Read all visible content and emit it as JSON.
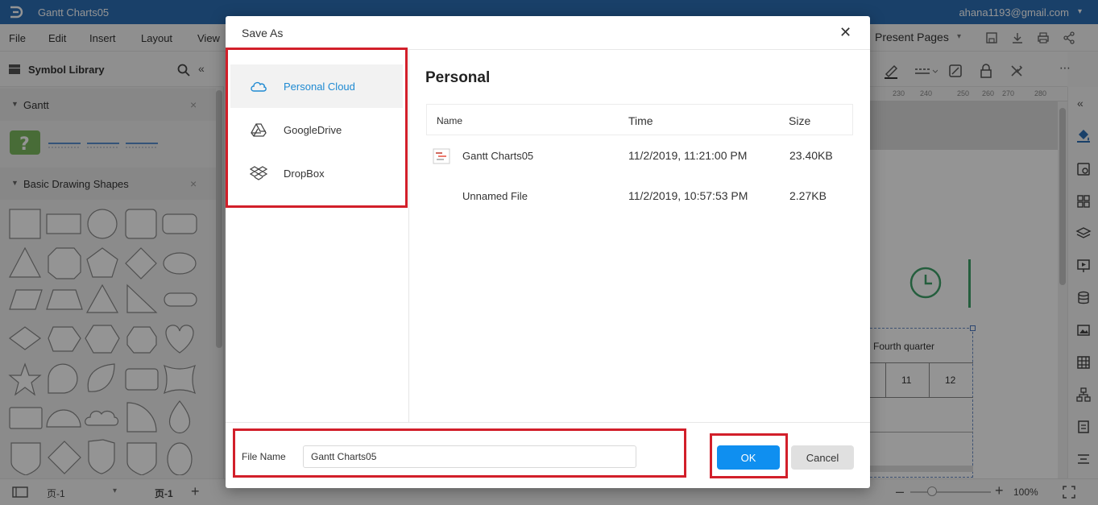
{
  "app": {
    "document_title": "Gantt Charts05",
    "account": "ahana1193@gmail.com",
    "menu": [
      "File",
      "Edit",
      "Insert",
      "Layout",
      "View"
    ],
    "present_pages": "Present Pages"
  },
  "sidebar": {
    "title": "Symbol Library",
    "sections": [
      {
        "label": "Gantt"
      },
      {
        "label": "Basic Drawing Shapes"
      }
    ]
  },
  "canvas": {
    "ruler_ticks": [
      "230",
      "240",
      "250",
      "260",
      "270",
      "280"
    ],
    "quarter_label": "Fourth quarter",
    "months": [
      "11",
      "12"
    ]
  },
  "statusbar": {
    "page_select": "页-1",
    "page_tab": "页-1",
    "zoom": "100%",
    "zoom_level": 0.2
  },
  "dialog": {
    "title": "Save As",
    "storage": [
      {
        "label": "Personal Cloud",
        "icon": "cloud-icon",
        "active": true
      },
      {
        "label": "GoogleDrive",
        "icon": "google-drive-icon",
        "active": false
      },
      {
        "label": "DropBox",
        "icon": "dropbox-icon",
        "active": false
      }
    ],
    "folder_title": "Personal",
    "columns": {
      "name": "Name",
      "time": "Time",
      "size": "Size"
    },
    "files": [
      {
        "name": "Gantt Charts05",
        "time": "11/2/2019, 11:21:00 PM",
        "size": "23.40KB",
        "has_thumbnail": true
      },
      {
        "name": "Unnamed File",
        "time": "11/2/2019, 10:57:53 PM",
        "size": "2.27KB",
        "has_thumbnail": false
      }
    ],
    "file_name_label": "File Name",
    "file_name_value": "Gantt Charts05",
    "ok_label": "OK",
    "cancel_label": "Cancel"
  },
  "colors": {
    "titlebar": "#2b6eb6",
    "accent": "#0f8ff0",
    "active_storage_text": "#1f8ad2",
    "annotation": "#d21f2a",
    "gantt_green": "#3fa36a"
  }
}
